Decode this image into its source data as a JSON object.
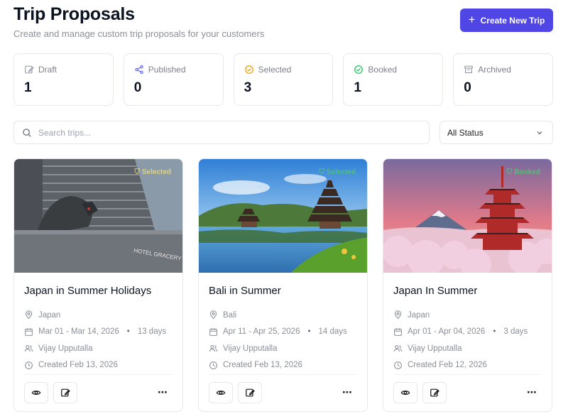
{
  "header": {
    "title": "Trip Proposals",
    "subtitle": "Create and manage custom trip proposals for your customers",
    "create_button_label": "Create New Trip"
  },
  "stats": [
    {
      "label": "Draft",
      "value": "1",
      "icon": "draft-icon",
      "color": "#9ca3af"
    },
    {
      "label": "Published",
      "value": "0",
      "icon": "share-icon",
      "color": "#6366f1"
    },
    {
      "label": "Selected",
      "value": "3",
      "icon": "check-circle-icon",
      "color": "#f59e0b"
    },
    {
      "label": "Booked",
      "value": "1",
      "icon": "check-circle-icon",
      "color": "#22c55e"
    },
    {
      "label": "Archived",
      "value": "0",
      "icon": "archive-icon",
      "color": "#9ca3af"
    }
  ],
  "filters": {
    "search_placeholder": "Search trips...",
    "status_selected": "All Status"
  },
  "trips": [
    {
      "title": "Japan in Summer Holidays",
      "image_badge": "Selected",
      "location": "Japan",
      "dates": "Mar 01 - Mar 14, 2026",
      "duration": "13 days",
      "agent": "Vijay Upputalla",
      "created": "Created Feb 13, 2026"
    },
    {
      "title": "Bali in Summer",
      "image_badge": "Selected",
      "location": "Bali",
      "dates": "Apr 11 - Apr 25, 2026",
      "duration": "14 days",
      "agent": "Vijay Upputalla",
      "created": "Created Feb 13, 2026"
    },
    {
      "title": "Japan In Summer",
      "image_badge": "Booked",
      "location": "Japan",
      "dates": "Apr 01 - Apr 04, 2026",
      "duration": "3 days",
      "agent": "Vijay Upputalla",
      "created": "Created Feb 12, 2026"
    }
  ],
  "colors": {
    "accent": "#4f46e5",
    "muted_text": "#8a8f98",
    "border": "#e7e8ec"
  }
}
